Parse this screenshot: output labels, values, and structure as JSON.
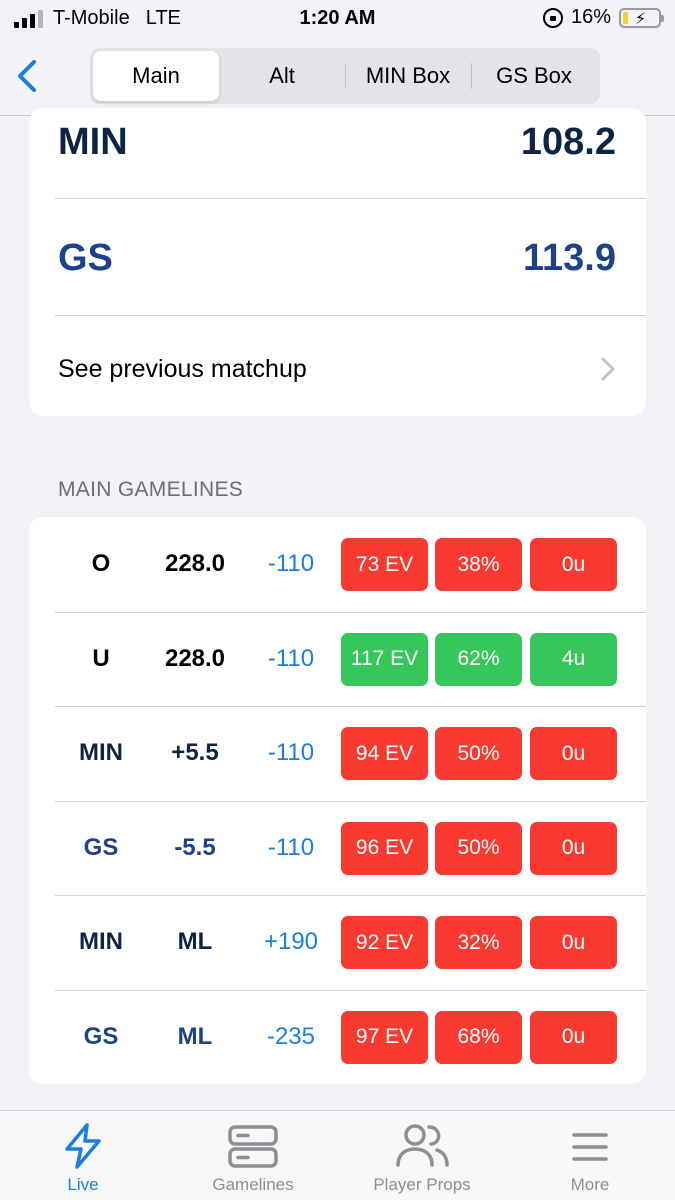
{
  "status_bar": {
    "carrier": "T-Mobile",
    "network": "LTE",
    "time": "1:20 AM",
    "battery": "16%",
    "battery_level": 0.16
  },
  "nav": {
    "tabs": [
      {
        "label": "Main",
        "active": true
      },
      {
        "label": "Alt",
        "active": false
      },
      {
        "label": "MIN Box",
        "active": false
      },
      {
        "label": "GS Box",
        "active": false
      }
    ]
  },
  "scores": [
    {
      "team": "MIN",
      "value": "108.2"
    },
    {
      "team": "GS",
      "value": "113.9"
    }
  ],
  "previous_matchup": "See previous matchup",
  "section_header": "MAIN GAMELINES",
  "gamelines": [
    {
      "team": "O",
      "line": "228.0",
      "odds": "-110",
      "ev": "73 EV",
      "pct": "38%",
      "units": "0u",
      "color": "red"
    },
    {
      "team": "U",
      "line": "228.0",
      "odds": "-110",
      "ev": "117 EV",
      "pct": "62%",
      "units": "4u",
      "color": "green"
    },
    {
      "team": "MIN",
      "line": "+5.5",
      "odds": "-110",
      "ev": "94 EV",
      "pct": "50%",
      "units": "0u",
      "color": "red"
    },
    {
      "team": "GS",
      "line": "-5.5",
      "odds": "-110",
      "ev": "96 EV",
      "pct": "50%",
      "units": "0u",
      "color": "red"
    },
    {
      "team": "MIN",
      "line": "ML",
      "odds": "+190",
      "ev": "92 EV",
      "pct": "32%",
      "units": "0u",
      "color": "red"
    },
    {
      "team": "GS",
      "line": "ML",
      "odds": "-235",
      "ev": "97 EV",
      "pct": "68%",
      "units": "0u",
      "color": "red"
    }
  ],
  "tabbar": [
    {
      "label": "Live",
      "icon": "lightning-icon",
      "active": true
    },
    {
      "label": "Gamelines",
      "icon": "server-icon",
      "active": false
    },
    {
      "label": "Player Props",
      "icon": "people-icon",
      "active": false
    },
    {
      "label": "More",
      "icon": "menu-icon",
      "active": false
    }
  ],
  "colors": {
    "accent": "#1a7fe0",
    "min_team": "#0d2543",
    "gs_team": "#1d428a",
    "red": "#fa3a30",
    "green": "#35c759"
  }
}
